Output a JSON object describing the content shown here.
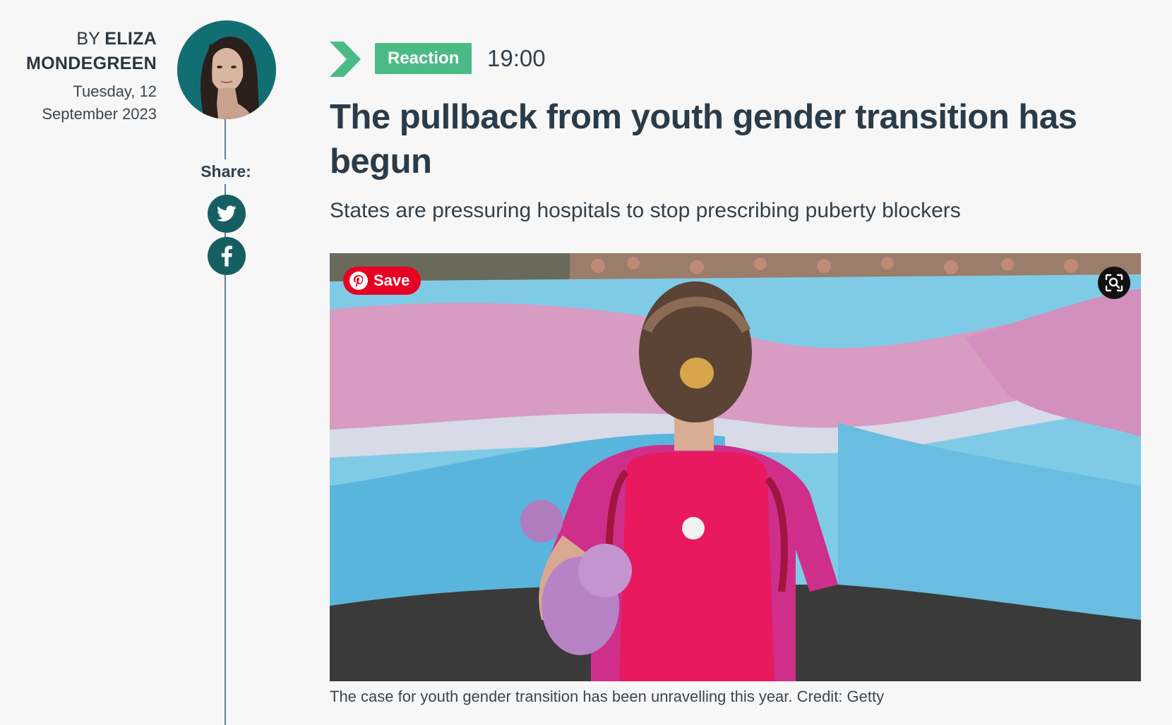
{
  "byline": {
    "prefix": "BY",
    "author_first": "ELIZA",
    "author_last": "MONDEGREEN",
    "date_line1": "Tuesday, 12",
    "date_line2": "September 2023"
  },
  "share": {
    "label": "Share:",
    "networks": [
      "twitter-icon",
      "facebook-icon"
    ]
  },
  "article": {
    "tag": "Reaction",
    "time": "19:00",
    "headline": "The pullback from youth gender transition has begun",
    "standfirst": "States are pressuring hospitals to stop prescribing puberty blockers",
    "caption": "The case for youth gender transition has been unravelling this year. Credit: Getty"
  },
  "image_overlay": {
    "save_label": "Save",
    "lens_icon": "visual-search-icon"
  },
  "colors": {
    "tag_green": "#4bbb85",
    "avatar_teal": "#116f74",
    "social_teal": "#155f63",
    "headline": "#2a3b4a",
    "pinterest_red": "#e60023"
  }
}
